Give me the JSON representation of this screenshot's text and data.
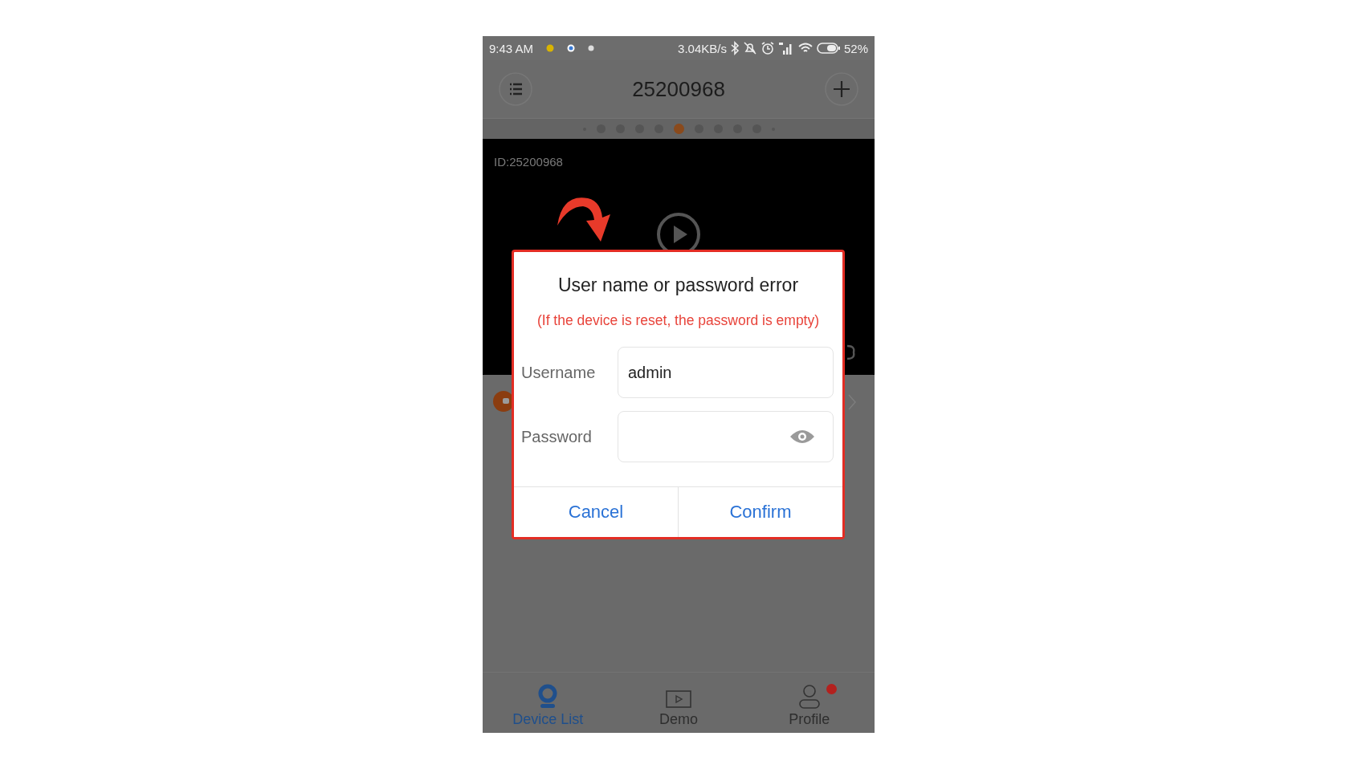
{
  "status_bar": {
    "time": "9:43 AM",
    "network_speed": "3.04KB/s",
    "battery": "52%"
  },
  "header": {
    "title": "25200968"
  },
  "page_dots": [
    {
      "kind": "small",
      "selected": false
    },
    {
      "kind": "normal",
      "selected": false
    },
    {
      "kind": "normal",
      "selected": false
    },
    {
      "kind": "normal",
      "selected": false
    },
    {
      "kind": "normal",
      "selected": false
    },
    {
      "kind": "normal",
      "selected": true
    },
    {
      "kind": "normal",
      "selected": false
    },
    {
      "kind": "normal",
      "selected": false
    },
    {
      "kind": "normal",
      "selected": false
    },
    {
      "kind": "normal",
      "selected": false
    },
    {
      "kind": "small",
      "selected": false
    }
  ],
  "camera": {
    "id_label": "ID:25200968"
  },
  "dialog": {
    "title": "User name or password error",
    "hint": "(If the device is reset, the password is empty)",
    "fields": [
      {
        "kind": "text",
        "label": "Username",
        "value": "admin"
      },
      {
        "kind": "password",
        "label": "Password"
      }
    ],
    "buttons": [
      "Cancel",
      "Confirm"
    ]
  },
  "tabs": [
    {
      "kind": "camera",
      "label": "Device List",
      "selected": true,
      "badge": false
    },
    {
      "kind": "demo",
      "label": "Demo",
      "selected": false,
      "badge": false
    },
    {
      "kind": "profile",
      "label": "Profile",
      "selected": false,
      "badge": true
    }
  ]
}
